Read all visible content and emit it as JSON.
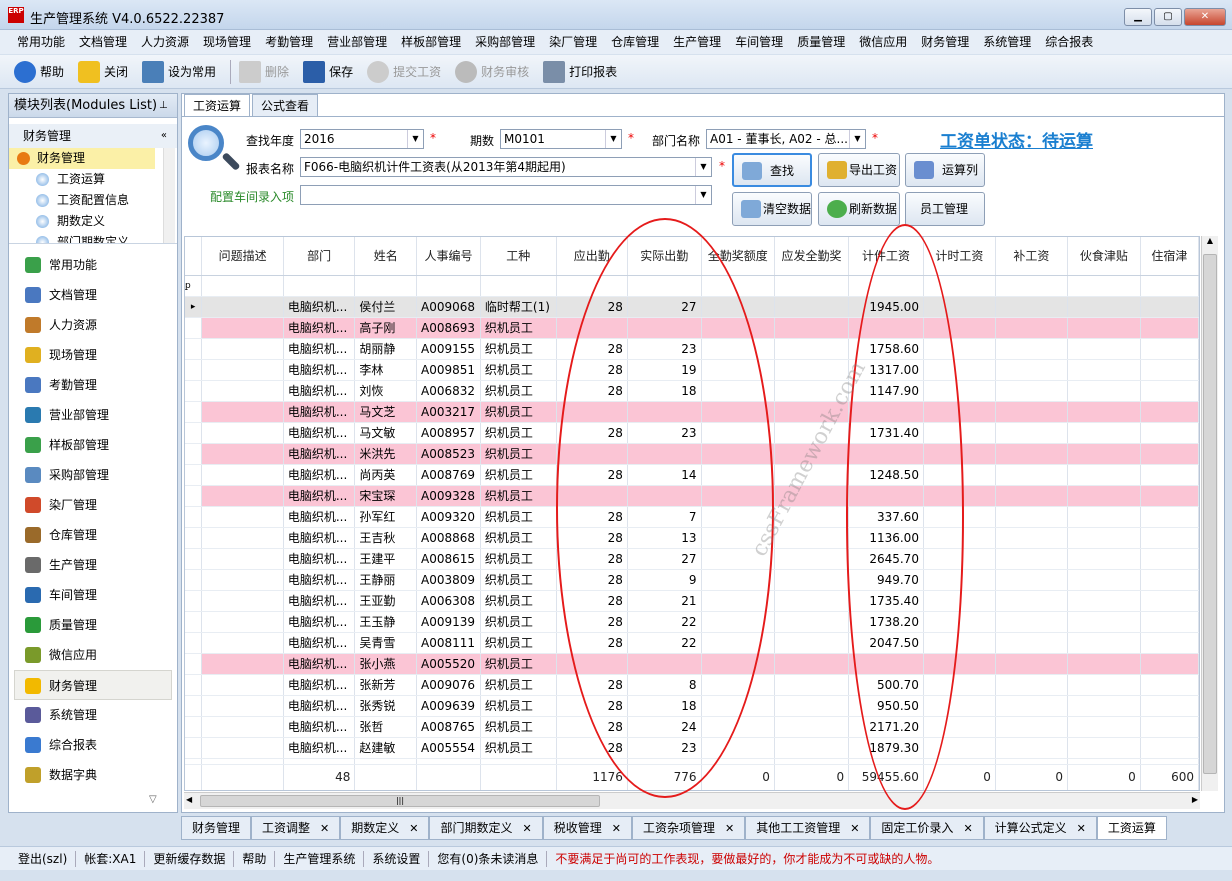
{
  "app": {
    "title": "生产管理系统 V4.0.6522.22387",
    "logo_text": "ERP"
  },
  "menu": [
    "常用功能",
    "文档管理",
    "人力资源",
    "现场管理",
    "考勤管理",
    "营业部管理",
    "样板部管理",
    "采购部管理",
    "染厂管理",
    "仓库管理",
    "生产管理",
    "车间管理",
    "质量管理",
    "微信应用",
    "财务管理",
    "系统管理",
    "综合报表"
  ],
  "toolbar": {
    "help": "帮助",
    "close": "关闭",
    "set_common": "设为常用",
    "delete": "删除",
    "save": "保存",
    "submit": "提交工资",
    "audit": "财务审核",
    "print": "打印报表"
  },
  "sidebar": {
    "title": "模块列表(Modules List)",
    "section": "财务管理",
    "tree_root": "财务管理",
    "tree_items": [
      "工资运算",
      "工资配置信息",
      "期数定义",
      "部门期数定义"
    ],
    "modules": [
      "常用功能",
      "文档管理",
      "人力资源",
      "现场管理",
      "考勤管理",
      "营业部管理",
      "样板部管理",
      "采购部管理",
      "染厂管理",
      "仓库管理",
      "生产管理",
      "车间管理",
      "质量管理",
      "微信应用",
      "财务管理",
      "系统管理",
      "综合报表",
      "数据字典"
    ]
  },
  "main": {
    "tabs": [
      "工资运算",
      "公式查看"
    ],
    "form": {
      "year_label": "查找年度",
      "year_value": "2016",
      "period_label": "期数",
      "period_value": "M0101",
      "dept_label": "部门名称",
      "dept_value": "A01 - 董事长, A02 - 总...",
      "report_label": "报表名称",
      "report_value": "F066-电脑织机计件工资表(从2013年第4期起用)",
      "workshop_label": "配置车间录入项",
      "workshop_value": "",
      "status_text": "工资单状态：待运算"
    },
    "buttons": {
      "search": "查找",
      "export": "导出工资",
      "calc_col": "运算列",
      "clear": "清空数据",
      "refresh": "刷新数据",
      "staff": "员工管理"
    }
  },
  "grid": {
    "columns": [
      "问题描述",
      "部门",
      "姓名",
      "人事编号",
      "工种",
      "应出勤",
      "实际出勤",
      "全勤奖额度",
      "应发全勤奖",
      "计件工资",
      "计时工资",
      "补工资",
      "伙食津贴",
      "住宿津"
    ],
    "rows": [
      {
        "dept": "电脑织机...",
        "name": "侯付兰",
        "id": "A009068",
        "type": "临时帮工(1)",
        "due": "28",
        "actual": "27",
        "piece": "1945.00",
        "pink": false,
        "sel": true
      },
      {
        "dept": "电脑织机...",
        "name": "高子刚",
        "id": "A008693",
        "type": "织机员工",
        "due": "",
        "actual": "",
        "piece": "",
        "pink": true
      },
      {
        "dept": "电脑织机...",
        "name": "胡丽静",
        "id": "A009155",
        "type": "织机员工",
        "due": "28",
        "actual": "23",
        "piece": "1758.60",
        "pink": false
      },
      {
        "dept": "电脑织机...",
        "name": "李林",
        "id": "A009851",
        "type": "织机员工",
        "due": "28",
        "actual": "19",
        "piece": "1317.00",
        "pink": false
      },
      {
        "dept": "电脑织机...",
        "name": "刘恢",
        "id": "A006832",
        "type": "织机员工",
        "due": "28",
        "actual": "18",
        "piece": "1147.90",
        "pink": false
      },
      {
        "dept": "电脑织机...",
        "name": "马文芝",
        "id": "A003217",
        "type": "织机员工",
        "due": "",
        "actual": "",
        "piece": "",
        "pink": true
      },
      {
        "dept": "电脑织机...",
        "name": "马文敏",
        "id": "A008957",
        "type": "织机员工",
        "due": "28",
        "actual": "23",
        "piece": "1731.40",
        "pink": false
      },
      {
        "dept": "电脑织机...",
        "name": "米洪先",
        "id": "A008523",
        "type": "织机员工",
        "due": "",
        "actual": "",
        "piece": "",
        "pink": true
      },
      {
        "dept": "电脑织机...",
        "name": "尚丙英",
        "id": "A008769",
        "type": "织机员工",
        "due": "28",
        "actual": "14",
        "piece": "1248.50",
        "pink": false
      },
      {
        "dept": "电脑织机...",
        "name": "宋宝琛",
        "id": "A009328",
        "type": "织机员工",
        "due": "",
        "actual": "",
        "piece": "",
        "pink": true
      },
      {
        "dept": "电脑织机...",
        "name": "孙军红",
        "id": "A009320",
        "type": "织机员工",
        "due": "28",
        "actual": "7",
        "piece": "337.60",
        "pink": false
      },
      {
        "dept": "电脑织机...",
        "name": "王吉秋",
        "id": "A008868",
        "type": "织机员工",
        "due": "28",
        "actual": "13",
        "piece": "1136.00",
        "pink": false
      },
      {
        "dept": "电脑织机...",
        "name": "王建平",
        "id": "A008615",
        "type": "织机员工",
        "due": "28",
        "actual": "27",
        "piece": "2645.70",
        "pink": false
      },
      {
        "dept": "电脑织机...",
        "name": "王静丽",
        "id": "A003809",
        "type": "织机员工",
        "due": "28",
        "actual": "9",
        "piece": "949.70",
        "pink": false
      },
      {
        "dept": "电脑织机...",
        "name": "王亚勤",
        "id": "A006308",
        "type": "织机员工",
        "due": "28",
        "actual": "21",
        "piece": "1735.40",
        "pink": false
      },
      {
        "dept": "电脑织机...",
        "name": "王玉静",
        "id": "A009139",
        "type": "织机员工",
        "due": "28",
        "actual": "22",
        "piece": "1738.20",
        "pink": false
      },
      {
        "dept": "电脑织机...",
        "name": "吴青雪",
        "id": "A008111",
        "type": "织机员工",
        "due": "28",
        "actual": "22",
        "piece": "2047.50",
        "pink": false
      },
      {
        "dept": "电脑织机...",
        "name": "张小燕",
        "id": "A005520",
        "type": "织机员工",
        "due": "",
        "actual": "",
        "piece": "",
        "pink": true
      },
      {
        "dept": "电脑织机...",
        "name": "张新芳",
        "id": "A009076",
        "type": "织机员工",
        "due": "28",
        "actual": "8",
        "piece": "500.70",
        "pink": false
      },
      {
        "dept": "电脑织机...",
        "name": "张秀锐",
        "id": "A009639",
        "type": "织机员工",
        "due": "28",
        "actual": "18",
        "piece": "950.50",
        "pink": false
      },
      {
        "dept": "电脑织机...",
        "name": "张哲",
        "id": "A008765",
        "type": "织机员工",
        "due": "28",
        "actual": "24",
        "piece": "2171.20",
        "pink": false
      },
      {
        "dept": "电脑织机...",
        "name": "赵建敏",
        "id": "A005554",
        "type": "织机员工",
        "due": "28",
        "actual": "23",
        "piece": "1879.30",
        "pink": false
      }
    ],
    "footer": {
      "count": "48",
      "due": "1176",
      "actual": "776",
      "full_quota": "0",
      "full_pay": "0",
      "piece": "59455.60",
      "time": "0",
      "supp": "0",
      "food": "0",
      "house": "600"
    }
  },
  "watermark": "cssFramework.com",
  "bottom_tabs": [
    "财务管理",
    "工资调整",
    "期数定义",
    "部门期数定义",
    "税收管理",
    "工资杂项管理",
    "其他工工资管理",
    "固定工价录入",
    "计算公式定义",
    "工资运算"
  ],
  "statusbar": {
    "logout": "登出(szl)",
    "account": "帐套:XA1",
    "refresh_cache": "更新缓存数据",
    "help": "帮助",
    "system": "生产管理系统",
    "settings": "系统设置",
    "unread": "您有(0)条未读消息",
    "motto": "不要满足于尚可的工作表现，要做最好的，你才能成为不可或缺的人物。"
  },
  "colors": {
    "pink_row": "#fbc5d5",
    "status_blue": "#1a7fd0",
    "annotation_red": "#e51b1b"
  }
}
